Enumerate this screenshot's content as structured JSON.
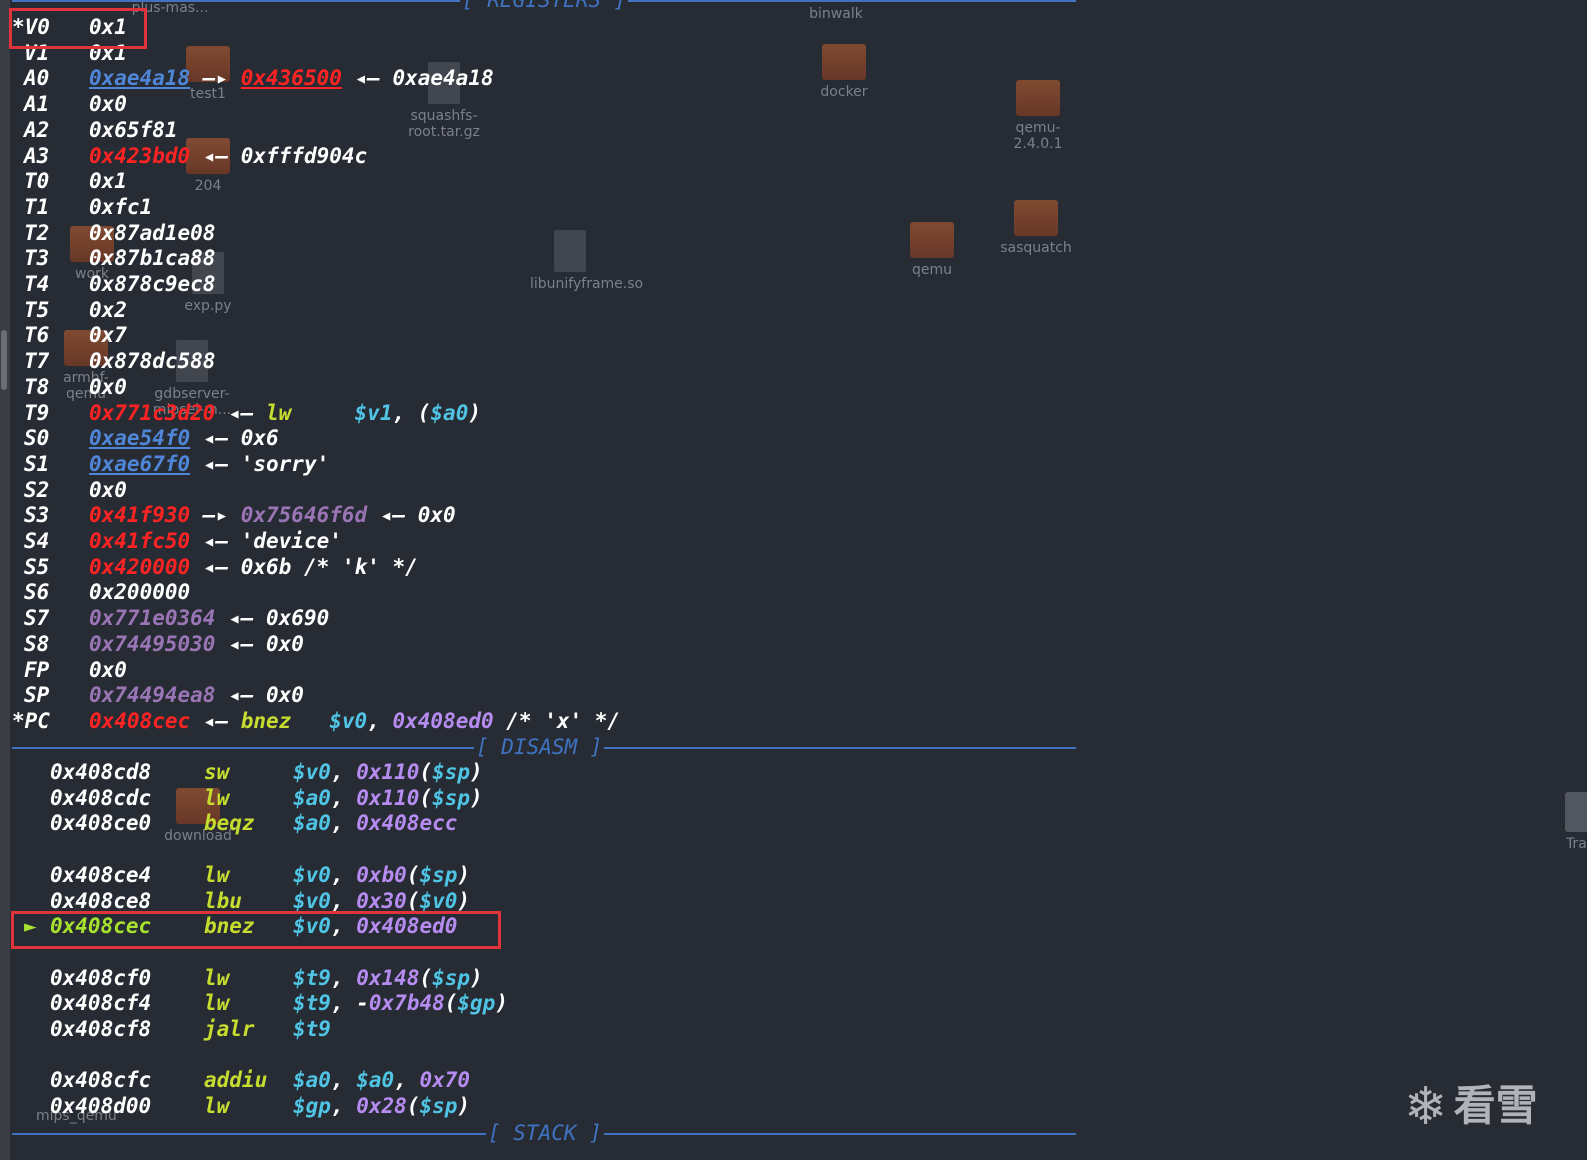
{
  "desktop_icons": [
    {
      "label": "binwalk",
      "type": "text"
    },
    {
      "label": "docker",
      "type": "folder"
    },
    {
      "label": "qemu-2.4.0.1",
      "type": "folder"
    },
    {
      "label": "sasquatch",
      "type": "folder"
    },
    {
      "label": "qemu",
      "type": "folder"
    },
    {
      "label": "squashfs-root.tar.gz",
      "type": "file"
    },
    {
      "label": "libunifyframe.so",
      "type": "file"
    },
    {
      "label": "test1",
      "type": "folder"
    },
    {
      "label": "204",
      "type": "folder"
    },
    {
      "label": "exp.py",
      "type": "file"
    },
    {
      "label": "gdbserver-mipsel-m...",
      "type": "file"
    },
    {
      "label": "download",
      "type": "folder"
    },
    {
      "label": "Tras",
      "type": "trash"
    },
    {
      "label": "plus-mas...",
      "type": "text"
    },
    {
      "label": "work",
      "type": "folder"
    },
    {
      "label": "armhf-qemu",
      "type": "folder"
    },
    {
      "label": "mips_qemu",
      "type": "text"
    }
  ],
  "registers": {
    "title": "[ REGISTERS ]",
    "rows": [
      {
        "name": "*V0",
        "parts": [
          {
            "t": "0x1",
            "c": "white"
          }
        ]
      },
      {
        "name": "V1",
        "parts": [
          {
            "t": "0x1",
            "c": "white"
          }
        ]
      },
      {
        "name": "A0",
        "parts": [
          {
            "t": "0xae4a18",
            "c": "link"
          },
          {
            "t": " —▸ ",
            "c": "arrow"
          },
          {
            "t": "0x436500",
            "c": "red-u"
          },
          {
            "t": " ◂— ",
            "c": "arrow"
          },
          {
            "t": "0xae4a18",
            "c": "white"
          }
        ]
      },
      {
        "name": "A1",
        "parts": [
          {
            "t": "0x0",
            "c": "white"
          }
        ]
      },
      {
        "name": "A2",
        "parts": [
          {
            "t": "0x65f81",
            "c": "white"
          }
        ]
      },
      {
        "name": "A3",
        "parts": [
          {
            "t": "0x423bd0",
            "c": "red"
          },
          {
            "t": " ◂— ",
            "c": "arrow"
          },
          {
            "t": "0xfffd904c",
            "c": "white"
          }
        ]
      },
      {
        "name": "T0",
        "parts": [
          {
            "t": "0x1",
            "c": "white"
          }
        ]
      },
      {
        "name": "T1",
        "parts": [
          {
            "t": "0xfc1",
            "c": "white"
          }
        ]
      },
      {
        "name": "T2",
        "parts": [
          {
            "t": "0x87ad1e08",
            "c": "white"
          }
        ]
      },
      {
        "name": "T3",
        "parts": [
          {
            "t": "0x87b1ca88",
            "c": "white"
          }
        ]
      },
      {
        "name": "T4",
        "parts": [
          {
            "t": "0x878c9ec8",
            "c": "white"
          }
        ]
      },
      {
        "name": "T5",
        "parts": [
          {
            "t": "0x2",
            "c": "white"
          }
        ]
      },
      {
        "name": "T6",
        "parts": [
          {
            "t": "0x7",
            "c": "white"
          }
        ]
      },
      {
        "name": "T7",
        "parts": [
          {
            "t": "0x878dc588",
            "c": "white"
          }
        ]
      },
      {
        "name": "T8",
        "parts": [
          {
            "t": "0x0",
            "c": "white"
          }
        ]
      },
      {
        "name": "T9",
        "parts": [
          {
            "t": "0x771c3d20",
            "c": "red"
          },
          {
            "t": " ◂— ",
            "c": "arrow"
          },
          {
            "t": "lw",
            "c": "yellow"
          },
          {
            "t": "     ",
            "c": "white"
          },
          {
            "t": "$v1",
            "c": "cyan"
          },
          {
            "t": ", (",
            "c": "white"
          },
          {
            "t": "$a0",
            "c": "cyan"
          },
          {
            "t": ")",
            "c": "white"
          }
        ]
      },
      {
        "name": "S0",
        "parts": [
          {
            "t": "0xae54f0",
            "c": "link"
          },
          {
            "t": " ◂— ",
            "c": "arrow"
          },
          {
            "t": "0x6",
            "c": "white"
          }
        ]
      },
      {
        "name": "S1",
        "parts": [
          {
            "t": "0xae67f0",
            "c": "link"
          },
          {
            "t": " ◂— ",
            "c": "arrow"
          },
          {
            "t": "'sorry'",
            "c": "white"
          }
        ]
      },
      {
        "name": "S2",
        "parts": [
          {
            "t": "0x0",
            "c": "white"
          }
        ]
      },
      {
        "name": "S3",
        "parts": [
          {
            "t": "0x41f930",
            "c": "red"
          },
          {
            "t": " —▸ ",
            "c": "arrow"
          },
          {
            "t": "0x75646f6d",
            "c": "purple"
          },
          {
            "t": " ◂— ",
            "c": "arrow"
          },
          {
            "t": "0x0",
            "c": "white"
          }
        ]
      },
      {
        "name": "S4",
        "parts": [
          {
            "t": "0x41fc50",
            "c": "red"
          },
          {
            "t": " ◂— ",
            "c": "arrow"
          },
          {
            "t": "'device'",
            "c": "white"
          }
        ]
      },
      {
        "name": "S5",
        "parts": [
          {
            "t": "0x420000",
            "c": "red"
          },
          {
            "t": " ◂— ",
            "c": "arrow"
          },
          {
            "t": "0x6b /* 'k' */",
            "c": "white"
          }
        ]
      },
      {
        "name": "S6",
        "parts": [
          {
            "t": "0x200000",
            "c": "white"
          }
        ]
      },
      {
        "name": "S7",
        "parts": [
          {
            "t": "0x771e0364",
            "c": "purple"
          },
          {
            "t": " ◂— ",
            "c": "arrow"
          },
          {
            "t": "0x690",
            "c": "white"
          }
        ]
      },
      {
        "name": "S8",
        "parts": [
          {
            "t": "0x74495030",
            "c": "purple"
          },
          {
            "t": " ◂— ",
            "c": "arrow"
          },
          {
            "t": "0x0",
            "c": "white"
          }
        ]
      },
      {
        "name": "FP",
        "parts": [
          {
            "t": "0x0",
            "c": "white"
          }
        ]
      },
      {
        "name": "SP",
        "parts": [
          {
            "t": "0x74494ea8",
            "c": "purple"
          },
          {
            "t": " ◂— ",
            "c": "arrow"
          },
          {
            "t": "0x0",
            "c": "white"
          }
        ]
      },
      {
        "name": "*PC",
        "parts": [
          {
            "t": "0x408cec",
            "c": "red"
          },
          {
            "t": " ◂— ",
            "c": "arrow"
          },
          {
            "t": "bnez",
            "c": "yellow"
          },
          {
            "t": "   ",
            "c": "white"
          },
          {
            "t": "$v0",
            "c": "cyan"
          },
          {
            "t": ", ",
            "c": "white"
          },
          {
            "t": "0x408ed0",
            "c": "violet"
          },
          {
            "t": " /* 'x' */",
            "c": "white"
          }
        ]
      }
    ]
  },
  "disasm": {
    "title": "[ DISASM ]",
    "lines": [
      {
        "addr": "0x408cd8",
        "op": "sw",
        "args": [
          {
            "t": "$v0",
            "c": "cyan"
          },
          {
            "t": ", ",
            "c": "white"
          },
          {
            "t": "0x110",
            "c": "violet"
          },
          {
            "t": "(",
            "c": "white"
          },
          {
            "t": "$sp",
            "c": "cyan"
          },
          {
            "t": ")",
            "c": "white"
          }
        ]
      },
      {
        "addr": "0x408cdc",
        "op": "lw",
        "args": [
          {
            "t": "$a0",
            "c": "cyan"
          },
          {
            "t": ", ",
            "c": "white"
          },
          {
            "t": "0x110",
            "c": "violet"
          },
          {
            "t": "(",
            "c": "white"
          },
          {
            "t": "$sp",
            "c": "cyan"
          },
          {
            "t": ")",
            "c": "white"
          }
        ]
      },
      {
        "addr": "0x408ce0",
        "op": "beqz",
        "args": [
          {
            "t": "$a0",
            "c": "cyan"
          },
          {
            "t": ", ",
            "c": "white"
          },
          {
            "t": "0x408ecc",
            "c": "violet"
          }
        ]
      },
      {
        "addr": "",
        "op": "",
        "args": []
      },
      {
        "addr": "0x408ce4",
        "op": "lw",
        "args": [
          {
            "t": "$v0",
            "c": "cyan"
          },
          {
            "t": ", ",
            "c": "white"
          },
          {
            "t": "0xb0",
            "c": "violet"
          },
          {
            "t": "(",
            "c": "white"
          },
          {
            "t": "$sp",
            "c": "cyan"
          },
          {
            "t": ")",
            "c": "white"
          }
        ]
      },
      {
        "addr": "0x408ce8",
        "op": "lbu",
        "args": [
          {
            "t": "$v0",
            "c": "cyan"
          },
          {
            "t": ", ",
            "c": "white"
          },
          {
            "t": "0x30",
            "c": "violet"
          },
          {
            "t": "(",
            "c": "white"
          },
          {
            "t": "$v0",
            "c": "cyan"
          },
          {
            "t": ")",
            "c": "white"
          }
        ]
      },
      {
        "addr": "0x408cec",
        "op": "bnez",
        "current": true,
        "args": [
          {
            "t": "$v0",
            "c": "cyan"
          },
          {
            "t": ", ",
            "c": "white"
          },
          {
            "t": "0x408ed0",
            "c": "violet"
          }
        ]
      },
      {
        "addr": "",
        "op": "",
        "args": []
      },
      {
        "addr": "0x408cf0",
        "op": "lw",
        "args": [
          {
            "t": "$t9",
            "c": "cyan"
          },
          {
            "t": ", ",
            "c": "white"
          },
          {
            "t": "0x148",
            "c": "violet"
          },
          {
            "t": "(",
            "c": "white"
          },
          {
            "t": "$sp",
            "c": "cyan"
          },
          {
            "t": ")",
            "c": "white"
          }
        ]
      },
      {
        "addr": "0x408cf4",
        "op": "lw",
        "args": [
          {
            "t": "$t9",
            "c": "cyan"
          },
          {
            "t": ", -",
            "c": "white"
          },
          {
            "t": "0x7b48",
            "c": "violet"
          },
          {
            "t": "(",
            "c": "white"
          },
          {
            "t": "$gp",
            "c": "cyan"
          },
          {
            "t": ")",
            "c": "white"
          }
        ]
      },
      {
        "addr": "0x408cf8",
        "op": "jalr",
        "args": [
          {
            "t": "$t9",
            "c": "cyan"
          }
        ]
      },
      {
        "addr": "",
        "op": "",
        "args": []
      },
      {
        "addr": "0x408cfc",
        "op": "addiu",
        "args": [
          {
            "t": "$a0",
            "c": "cyan"
          },
          {
            "t": ", ",
            "c": "white"
          },
          {
            "t": "$a0",
            "c": "cyan"
          },
          {
            "t": ", ",
            "c": "white"
          },
          {
            "t": "0x70",
            "c": "violet"
          }
        ]
      },
      {
        "addr": "0x408d00",
        "op": "lw",
        "args": [
          {
            "t": "$gp",
            "c": "cyan"
          },
          {
            "t": ", ",
            "c": "white"
          },
          {
            "t": "0x28",
            "c": "violet"
          },
          {
            "t": "(",
            "c": "white"
          },
          {
            "t": "$sp",
            "c": "cyan"
          },
          {
            "t": ")",
            "c": "white"
          }
        ]
      }
    ],
    "current_marker": "►"
  },
  "stack": {
    "title": "[ STACK ]"
  },
  "watermark": {
    "text": "看雪",
    "icon": "snowflake-icon"
  },
  "colors": {
    "background": "#272b33",
    "separator": "#3f73c1",
    "red_pointer": "#ff2323",
    "link_pointer": "#4f86d8",
    "purple_pointer": "#9a75b5",
    "mnemonic": "#c6dd30",
    "register_ref": "#4fc4e4",
    "immediate": "#b68cf0",
    "current_line": "#a6e22e",
    "highlight_box": "#e0333a"
  }
}
